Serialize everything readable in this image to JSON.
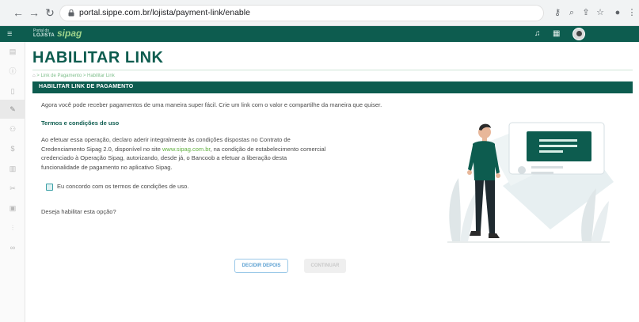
{
  "browser": {
    "url": "portal.sippe.com.br/lojista/payment-link/enable",
    "back_icon": "arrow-left-icon",
    "forward_icon": "arrow-right-icon",
    "reload_icon": "reload-icon"
  },
  "header": {
    "brand_line1": "Portal do",
    "brand_line2": "LOJISTA",
    "brand_logo": "sipag",
    "colors": {
      "primary": "#0d5c4f",
      "accent": "#9ed38b"
    }
  },
  "sidebar": {
    "items": [
      {
        "icon": "storefront-icon"
      },
      {
        "icon": "info-icon"
      },
      {
        "icon": "mobile-icon"
      },
      {
        "icon": "pencil-icon",
        "active": true
      },
      {
        "icon": "users-icon"
      },
      {
        "icon": "dollar-icon"
      },
      {
        "icon": "document-icon"
      },
      {
        "icon": "tools-icon"
      },
      {
        "icon": "database-icon"
      },
      {
        "icon": "sliders-icon"
      },
      {
        "icon": "link-icon"
      }
    ]
  },
  "page": {
    "title": "HABILITAR LINK",
    "breadcrumbs": [
      "Link de Pagamento",
      "Habilitar Link"
    ],
    "section_title": "HABILITAR LINK DE PAGAMENTO",
    "intro": "Agora você pode receber pagamentos de uma maneira super fácil. Crie um link com o valor e compartilhe da maneira que quiser.",
    "terms_title": "Termos e condições de uso",
    "terms_text_1": "Ao efetuar essa operação, declaro aderir integralmente às condições dispostas no Contrato de Credenciamento Sipag 2.0, disponível no site ",
    "terms_link": "www.sipag.com.br",
    "terms_text_2": ", na condição de estabelecimento comercial credenciado à Operação Sipag, autorizando, desde já, o Bancoob a efetuar a liberação desta funcionalidade de pagamento no aplicativo Sipag.",
    "agree_label": "Eu concordo com os termos de condições de uso.",
    "agree_checked": false,
    "question": "Deseja habilitar esta opção?",
    "decide_later_label": "DECIDIR DEPOIS",
    "continue_label": "CONTINUAR"
  }
}
